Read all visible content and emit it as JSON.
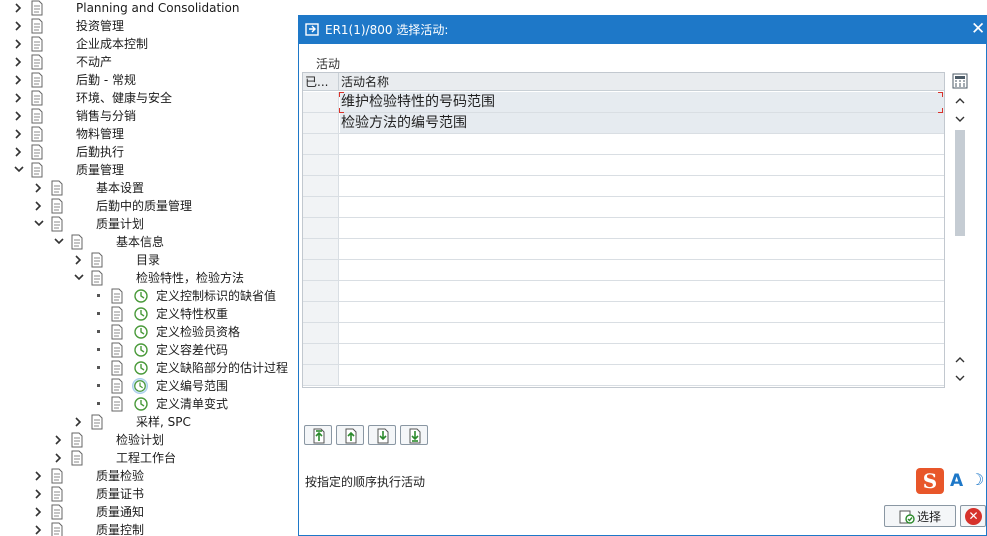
{
  "tree": {
    "items": [
      {
        "label": "Planning and Consolidation",
        "expanded": false
      },
      {
        "label": "投资管理",
        "expanded": false
      },
      {
        "label": "企业成本控制",
        "expanded": false
      },
      {
        "label": "不动产",
        "expanded": false
      },
      {
        "label": "后勤 - 常规",
        "expanded": false
      },
      {
        "label": "环境、健康与安全",
        "expanded": false
      },
      {
        "label": "销售与分销",
        "expanded": false
      },
      {
        "label": "物料管理",
        "expanded": false
      },
      {
        "label": "后勤执行",
        "expanded": false
      },
      {
        "label": "质量管理",
        "expanded": true
      },
      {
        "label": "基本设置",
        "expanded": false
      },
      {
        "label": "后勤中的质量管理",
        "expanded": false
      },
      {
        "label": "质量计划",
        "expanded": true
      },
      {
        "label": "基本信息",
        "expanded": true
      },
      {
        "label": "目录",
        "expanded": false
      },
      {
        "label": "检验特性，检验方法",
        "expanded": true
      },
      {
        "label": "定义控制标识的缺省值"
      },
      {
        "label": "定义特性权重"
      },
      {
        "label": "定义检验员资格"
      },
      {
        "label": "定义容差代码"
      },
      {
        "label": "定义缺陷部分的估计过程"
      },
      {
        "label": "定义编号范围",
        "selected": true
      },
      {
        "label": "定义清单变式"
      },
      {
        "label": "采样, SPC",
        "expanded": false
      },
      {
        "label": "检验计划",
        "expanded": false
      },
      {
        "label": "工程工作台",
        "expanded": false
      },
      {
        "label": "质量检验",
        "expanded": false
      },
      {
        "label": "质量证书",
        "expanded": false
      },
      {
        "label": "质量通知",
        "expanded": false
      },
      {
        "label": "质量控制",
        "expanded": false
      }
    ]
  },
  "dialog": {
    "title": "ER1(1)/800 选择活动:",
    "close_icon": "close-icon",
    "menu_label": "活动",
    "table": {
      "col_done": "已...",
      "col_name": "活动名称",
      "rows": [
        {
          "name": "维护检验特性的号码范围"
        },
        {
          "name": "检验方法的编号范围"
        }
      ]
    },
    "status_text": "按指定的顺序执行活动",
    "ime": {
      "logo": "S",
      "mode": "A"
    },
    "ok_label": "选择",
    "cancel_icon": "cancel-icon"
  }
}
